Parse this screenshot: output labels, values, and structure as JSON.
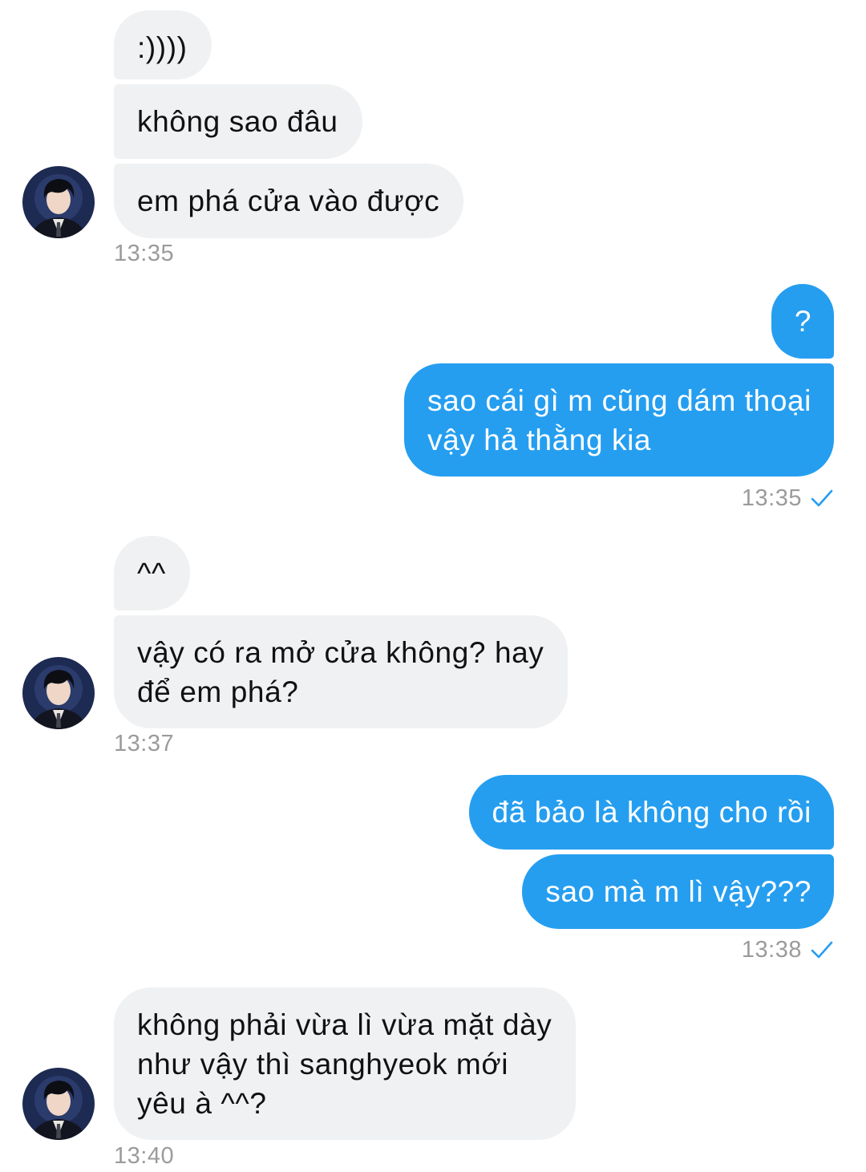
{
  "conversation": {
    "group1": {
      "messages": [
        ":))))",
        "không sao đâu",
        "em phá cửa vào được"
      ],
      "time": "13:35"
    },
    "group2": {
      "messages": [
        "?",
        "sao cái gì m cũng dám thoại\nvậy hả thằng kia"
      ],
      "time": "13:35"
    },
    "group3": {
      "messages": [
        "^^",
        "vậy có ra mở cửa không? hay\nđể em phá?"
      ],
      "time": "13:37"
    },
    "group4": {
      "messages": [
        "đã bảo là không cho rồi",
        "sao mà m lì vậy???"
      ],
      "time": "13:38"
    },
    "group5": {
      "messages": [
        "không phải vừa lì vừa mặt dày\nnhư vậy thì sanghyeok mới\nyêu à ^^?"
      ],
      "time": "13:40"
    }
  },
  "colors": {
    "incoming_bubble": "#f0f1f3",
    "outgoing_bubble": "#259ef0",
    "timestamp": "#9b9b9b",
    "read_check": "#259ef0"
  },
  "icons": {
    "avatar": "contact-avatar",
    "read_receipt": "check-icon"
  }
}
